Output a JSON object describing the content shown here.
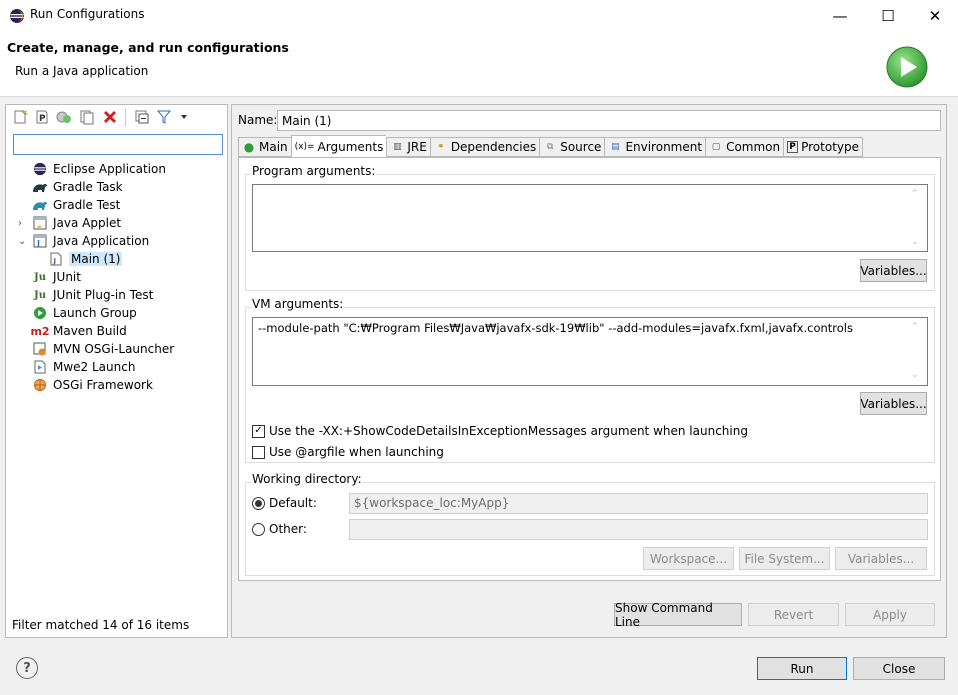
{
  "window": {
    "title": "Run Configurations",
    "controls": {
      "minimize": "—",
      "maximize": "☐",
      "close": "✕"
    }
  },
  "header": {
    "title": "Create, manage, and run configurations",
    "subtitle": "Run a Java application",
    "icon": "run-green-icon"
  },
  "left": {
    "toolbar_icons": [
      "new-config-icon",
      "new-prototype-icon",
      "export-icon",
      "duplicate-icon",
      "delete-icon",
      "collapse-all-icon",
      "filter-icon",
      "view-menu-icon"
    ],
    "filter_value": "",
    "tree": [
      {
        "label": "Eclipse Application",
        "icon": "eclipse-icon"
      },
      {
        "label": "Gradle Task",
        "icon": "gradle-icon"
      },
      {
        "label": "Gradle Test",
        "icon": "gradle-test-icon"
      },
      {
        "label": "Java Applet",
        "icon": "applet-icon"
      },
      {
        "label": "Java Application",
        "icon": "java-app-icon"
      },
      {
        "label": "Main (1)",
        "icon": "java-file-icon"
      },
      {
        "label": "JUnit",
        "icon": "junit-icon"
      },
      {
        "label": "JUnit Plug-in Test",
        "icon": "junit-plugin-icon"
      },
      {
        "label": "Launch Group",
        "icon": "launch-group-icon"
      },
      {
        "label": "Maven Build",
        "icon": "maven-icon"
      },
      {
        "label": "MVN OSGi-Launcher",
        "icon": "osgi-launcher-icon"
      },
      {
        "label": "Mwe2 Launch",
        "icon": "mwe2-icon"
      },
      {
        "label": "OSGi Framework",
        "icon": "osgi-icon"
      }
    ],
    "status": "Filter matched 14 of 16 items"
  },
  "right": {
    "name_label": "Name:",
    "name_value": "Main (1)",
    "tabs": [
      {
        "label": "Main",
        "icon": "main-tab-icon",
        "glyph": "⦿"
      },
      {
        "label": "Arguments",
        "icon": "arguments-tab-icon",
        "glyph": "(x)="
      },
      {
        "label": "JRE",
        "icon": "jre-tab-icon",
        "glyph": "▥"
      },
      {
        "label": "Dependencies",
        "icon": "dependencies-tab-icon",
        "glyph": "⚭"
      },
      {
        "label": "Source",
        "icon": "source-tab-icon",
        "glyph": "⧉"
      },
      {
        "label": "Environment",
        "icon": "environment-tab-icon",
        "glyph": "▤"
      },
      {
        "label": "Common",
        "icon": "common-tab-icon",
        "glyph": "▢"
      },
      {
        "label": "Prototype",
        "icon": "prototype-tab-icon",
        "glyph": "P"
      }
    ],
    "active_tab": "Arguments",
    "program_args_label": "Program arguments:",
    "program_args_value": "",
    "variables_label": "Variables...",
    "vm_args_label": "VM arguments:",
    "vm_args_value": "--module-path \"C:₩Program Files₩Java₩javafx-sdk-19₩lib\" --add-modules=javafx.fxml,javafx.controls",
    "show_code_details_label": "Use the -XX:+ShowCodeDetailsInExceptionMessages argument when launching",
    "show_code_details_checked": true,
    "argfile_label": "Use @argfile when launching",
    "argfile_checked": false,
    "working_dir_label": "Working directory:",
    "default_label": "Default:",
    "default_value": "${workspace_loc:MyApp}",
    "other_label": "Other:",
    "other_value": "",
    "workspace_btn": "Workspace...",
    "filesystem_btn": "File System...",
    "wd_variables_btn": "Variables...",
    "show_command_line": "Show Command Line",
    "revert": "Revert",
    "apply": "Apply"
  },
  "footer": {
    "help": "?",
    "run": "Run",
    "close": "Close"
  },
  "colors": {
    "accent": "#0078d7",
    "selection": "#cde8ff",
    "run_green": "#3cae3c"
  }
}
